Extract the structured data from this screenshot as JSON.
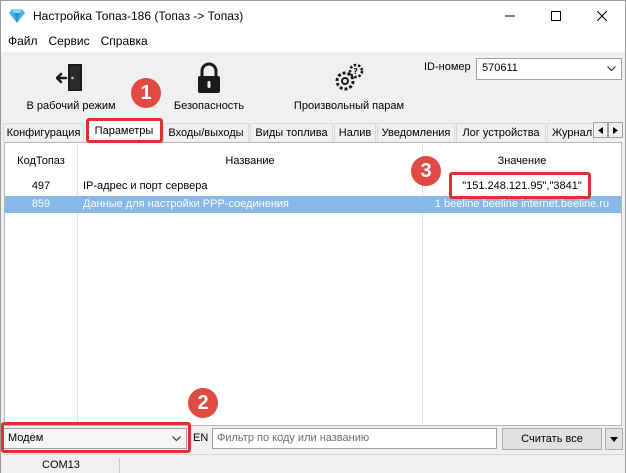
{
  "window": {
    "title": "Настройка Топаз-186 (Топаз -> Топаз)"
  },
  "menu": [
    "Файл",
    "Сервис",
    "Справка"
  ],
  "toolbar": {
    "work_mode_label": "В рабочий режим",
    "security_label": "Безопасность",
    "arbitrary_param_label": "Произвольный парам",
    "id_label": "ID-номер",
    "id_value": "570611"
  },
  "tabs": [
    "Конфигурация",
    "Параметры",
    "Входы/выходы",
    "Виды топлива",
    "Налив",
    "Уведомления",
    "Лог устройства",
    "Журнал"
  ],
  "active_tab": "Параметры",
  "table": {
    "columns": [
      "КодТопаз",
      "Название",
      "Значение"
    ],
    "rows": [
      {
        "code": "497",
        "name": "IP-адрес и порт сервера",
        "value": "\"151.248.121.95\",\"3841\""
      },
      {
        "code": "859",
        "name": "Данные для настройки PPP-соединения",
        "value": "1 beeline beeline internet.beeline.ru"
      }
    ]
  },
  "bottom": {
    "modem_select": "Модем",
    "lang": "EN",
    "filter_placeholder": "Фильтр по коду или названию",
    "read_all_label": "Считать все"
  },
  "status": {
    "port": "COM13"
  },
  "annotations": {
    "marker1": "1",
    "marker2": "2",
    "marker3": "3",
    "color": "#e04a43"
  },
  "colors": {
    "selection": "#87b8e6",
    "app_icon": "#4fb4e8"
  }
}
